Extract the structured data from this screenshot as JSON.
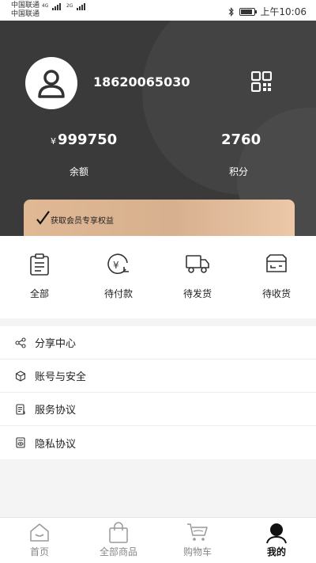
{
  "status_bar": {
    "carrier1": "中国联通",
    "carrier2": "中国联通",
    "net1": "4G",
    "net2": "2G",
    "time": "上午10:06"
  },
  "profile": {
    "phone": "18620065030",
    "balance_symbol": "¥",
    "balance_value": "999750",
    "balance_label": "余额",
    "points_value": "2760",
    "points_label": "积分",
    "member_card_text": "获取会员专享权益"
  },
  "orders": [
    {
      "label": "全部",
      "icon": "clipboard-icon"
    },
    {
      "label": "待付款",
      "icon": "payment-icon"
    },
    {
      "label": "待发货",
      "icon": "truck-icon"
    },
    {
      "label": "待收货",
      "icon": "box-icon"
    }
  ],
  "menu": [
    {
      "label": "分享中心",
      "icon": "share-icon"
    },
    {
      "label": "账号与安全",
      "icon": "shield-icon"
    },
    {
      "label": "服务协议",
      "icon": "document-icon"
    },
    {
      "label": "隐私协议",
      "icon": "privacy-icon"
    }
  ],
  "tabbar": [
    {
      "label": "首页",
      "icon": "home-icon",
      "active": false
    },
    {
      "label": "全部商品",
      "icon": "shopping-bag-icon",
      "active": false
    },
    {
      "label": "购物车",
      "icon": "cart-icon",
      "active": false
    },
    {
      "label": "我的",
      "icon": "user-icon",
      "active": true
    }
  ],
  "colors": {
    "header_bg": "#3a3a3a",
    "card_gold": "#d7b08f",
    "icon": "#333333"
  }
}
